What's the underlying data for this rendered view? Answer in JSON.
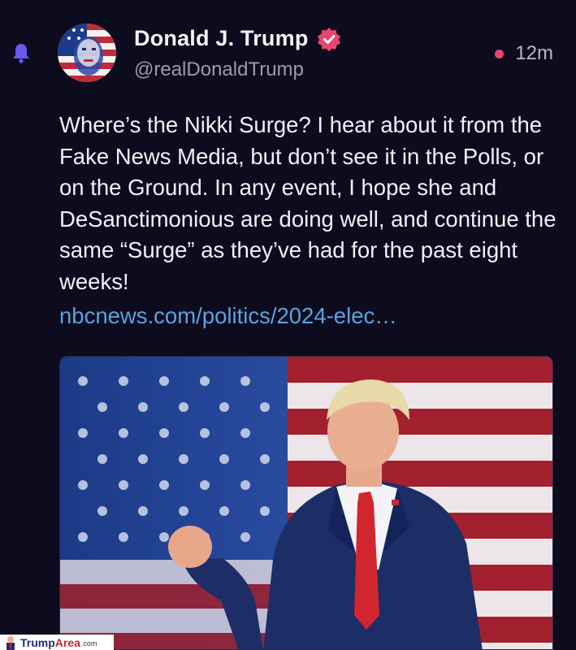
{
  "author": {
    "display_name": "Donald J. Trump",
    "handle": "@realDonaldTrump",
    "verified": true,
    "avatar_icon": "american-flag-portrait-avatar"
  },
  "post": {
    "time_ago": "12m",
    "text": "Where’s the Nikki Surge? I hear about it from the Fake News Media, but don’t see it in the Polls, or on the Ground. In any event, I hope she and DeSanctimonious are doing well, and continue the same “Surge” as they’ve had for the past eight weeks!",
    "link": "nbcnews.com/politics/2024-elec…",
    "media_icon": "man-in-suit-fist-raised-in-front-of-american-flag-photo"
  },
  "icons": {
    "notification": "bell-icon",
    "verified": "verified-badge-icon",
    "unread": "red-dot-icon"
  },
  "colors": {
    "background": "#0d0b1e",
    "bell": "#6a56f0",
    "verified_badge": "#e8456f",
    "unread_dot": "#e8456f",
    "link": "#5aa3e0"
  },
  "watermark": {
    "brand_part1": "Trump",
    "brand_part2": "Area",
    "domain": ".com"
  }
}
